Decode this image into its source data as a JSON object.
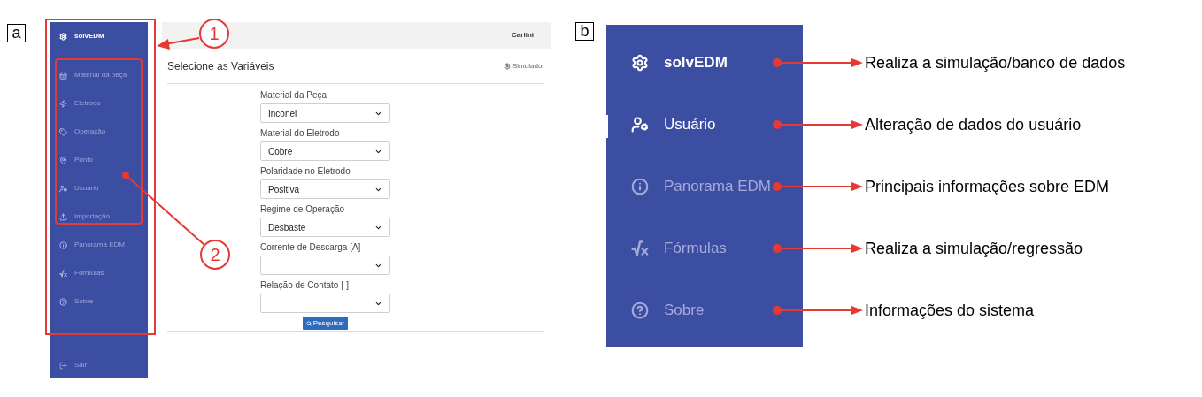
{
  "panel_a": {
    "label": "a",
    "sidebar": {
      "brand": "solvEDM",
      "items": [
        {
          "label": "Material da peça"
        },
        {
          "label": "Eletrodo"
        },
        {
          "label": "Operação"
        },
        {
          "label": "Ponto"
        },
        {
          "label": "Usuário"
        },
        {
          "label": "Importação"
        },
        {
          "label": "Panorama EDM"
        },
        {
          "label": "Fórmulas"
        },
        {
          "label": "Sobre"
        }
      ],
      "logout": "Sair"
    },
    "header": {
      "user": "Carlini"
    },
    "page": {
      "title": "Selecione as Variáveis",
      "action": "Simulador",
      "fields": [
        {
          "label": "Material da Peça",
          "value": "Inconel"
        },
        {
          "label": "Material do Eletrodo",
          "value": "Cobre"
        },
        {
          "label": "Polaridade no Eletrodo",
          "value": "Positiva"
        },
        {
          "label": "Regime de Operação",
          "value": "Desbaste"
        },
        {
          "label": "Corrente de Descarga [A]"
        },
        {
          "label": "Relação de Contato [-]"
        }
      ],
      "button": "Pesquisar"
    },
    "callouts": [
      "1",
      "2"
    ]
  },
  "panel_b": {
    "label": "b",
    "items": [
      {
        "kind": "brand",
        "label": "solvEDM",
        "annotation": "Realiza a simulação/banco de dados"
      },
      {
        "kind": "item",
        "label": "Usuário",
        "selected": true,
        "annotation": "Alteração de dados do usuário"
      },
      {
        "kind": "item",
        "label": "Panorama EDM",
        "selected": false,
        "annotation": "Principais informações sobre EDM"
      },
      {
        "kind": "item",
        "label": "Fórmulas",
        "selected": false,
        "annotation": "Realiza a simulação/regressão"
      },
      {
        "kind": "item",
        "label": "Sobre",
        "selected": false,
        "annotation": "Informações do sistema"
      }
    ]
  }
}
